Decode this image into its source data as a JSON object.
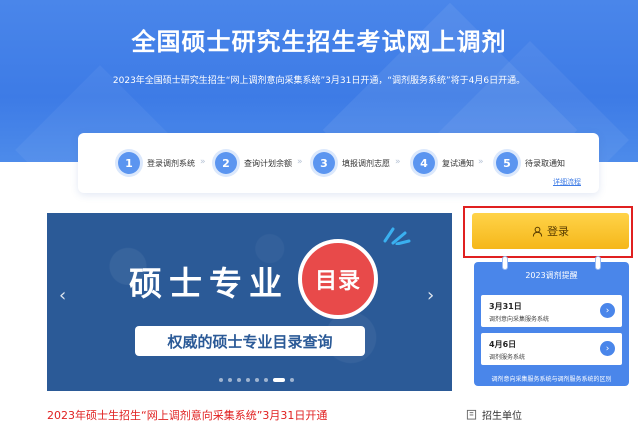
{
  "header": {
    "title": "全国硕士研究生招生考试网上调剂",
    "subtitle": "2023年全国硕士研究生招生“网上调剂意向采集系统”3月31日开通，“调剂服务系统”将于4月6日开通。"
  },
  "steps": {
    "items": [
      {
        "num": "1",
        "label": "登录调剂系统"
      },
      {
        "num": "2",
        "label": "查询计划余额"
      },
      {
        "num": "3",
        "label": "填报调剂志愿"
      },
      {
        "num": "4",
        "label": "复试通知"
      },
      {
        "num": "5",
        "label": "待录取通知"
      }
    ],
    "details_link": "详细流程"
  },
  "banner": {
    "main_text": "硕士专业",
    "badge_text": "目录",
    "sub_text": "权威的硕士专业目录查询",
    "prev_icon": "chevron-left-icon",
    "next_icon": "chevron-right-icon",
    "dot_count": 8,
    "active_dot": 7
  },
  "login": {
    "label": "登录",
    "icon": "user-icon",
    "highlight_color": "#e02020"
  },
  "reminder": {
    "title": "2023调剂提醒",
    "items": [
      {
        "date": "3月31日",
        "desc": "调剂意向采集服务系统"
      },
      {
        "date": "4月6日",
        "desc": "调剂服务系统"
      }
    ],
    "footer": "调剂意向采集服务系统与调剂服务系统的区别"
  },
  "news": {
    "headline": "2023年硕士生招生“网上调剂意向采集系统”3月31日开通"
  },
  "section": {
    "title": "招生单位",
    "icon": "building-icon"
  },
  "colors": {
    "primary_blue": "#3d7be6",
    "banner_blue": "#2b5a97",
    "accent_red": "#e02020",
    "login_yellow": "#f5b71a"
  }
}
